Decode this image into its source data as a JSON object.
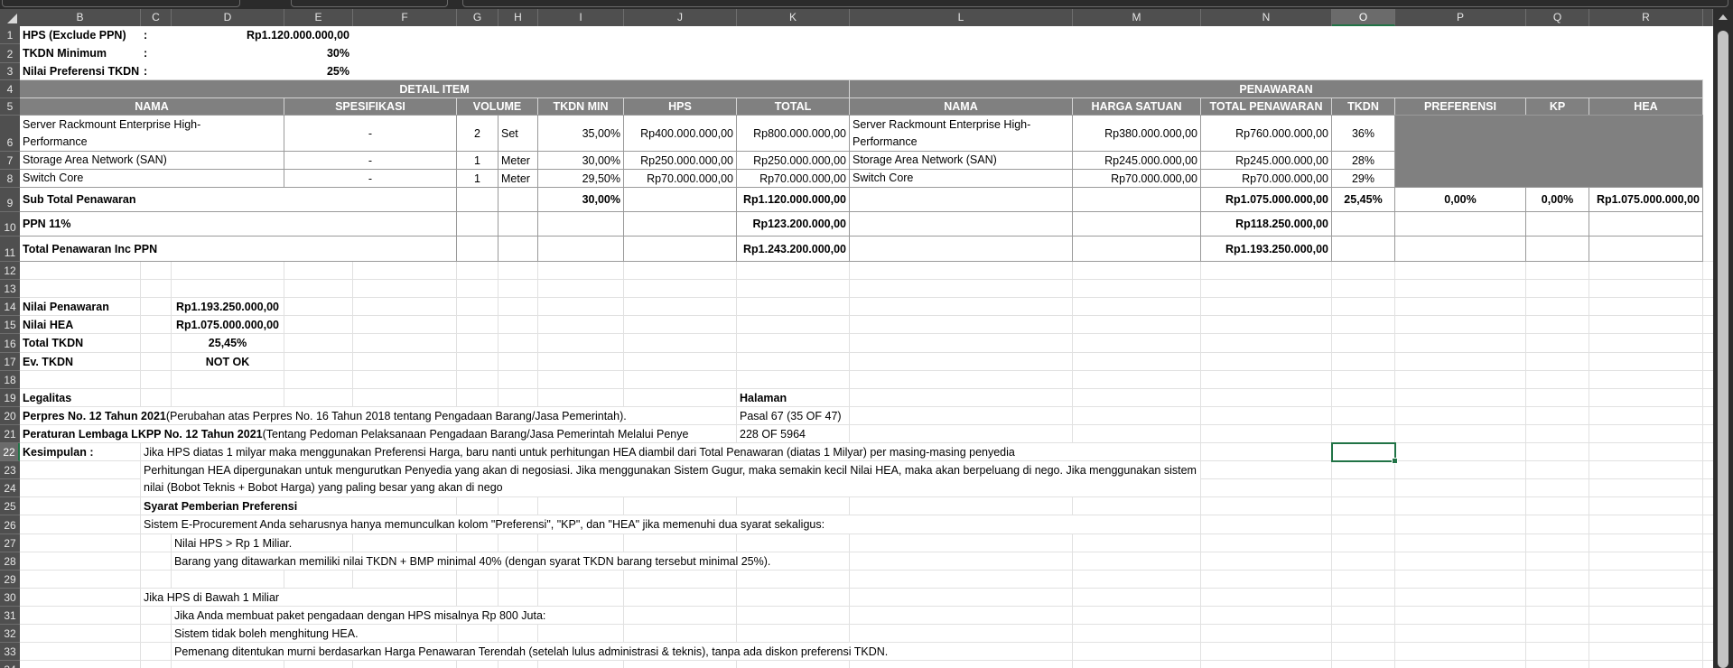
{
  "sheet": {
    "columns": [
      "B",
      "C",
      "D",
      "E",
      "F",
      "G",
      "H",
      "I",
      "J",
      "K",
      "L",
      "M",
      "N",
      "O",
      "P",
      "Q",
      "R"
    ],
    "rows": [
      "1",
      "2",
      "3",
      "4",
      "5",
      "6",
      "7",
      "8",
      "9",
      "10",
      "11",
      "12",
      "13",
      "14",
      "15",
      "16",
      "17",
      "18",
      "19",
      "20",
      "21",
      "22",
      "23",
      "24",
      "25",
      "26",
      "27",
      "28",
      "29",
      "30",
      "31",
      "32",
      "33",
      "34"
    ],
    "selected_cell": "O22",
    "accent_color": "#217346"
  },
  "summary": {
    "items": [
      {
        "label": "HPS (Exclude PPN)",
        "sep": ":",
        "value": "Rp1.120.000.000,00"
      },
      {
        "label": "TKDN Minimum",
        "sep": ":",
        "value": "30%"
      },
      {
        "label": "Nilai Preferensi TKDN",
        "sep": ":",
        "value": "25%"
      }
    ]
  },
  "table": {
    "detail_title": "DETAIL ITEM",
    "penawaran_title": "PENAWARAN",
    "headers": [
      "NAMA",
      "SPESIFIKASI",
      "VOLUME",
      "TKDN MIN",
      "HPS",
      "TOTAL",
      "NAMA",
      "HARGA SATUAN",
      "TOTAL PENAWARAN",
      "TKDN",
      "PREFERENSI",
      "KP",
      "HEA"
    ],
    "items": [
      {
        "nama": "Server Rackmount Enterprise High-Performance",
        "spesifikasi": "-",
        "volume": "2",
        "satuan": "Set",
        "tkdn_min": "35,00%",
        "hps": "Rp400.000.000,00",
        "total": "Rp800.000.000,00",
        "nama_penawaran": "Server Rackmount Enterprise High-Performance",
        "harga_satuan": "Rp380.000.000,00",
        "total_penawaran": "Rp760.000.000,00",
        "tkdn": "36%"
      },
      {
        "nama": "Storage Area Network (SAN)",
        "spesifikasi": "-",
        "volume": "1",
        "satuan": "Meter",
        "tkdn_min": "30,00%",
        "hps": "Rp250.000.000,00",
        "total": "Rp250.000.000,00",
        "nama_penawaran": "Storage Area Network (SAN)",
        "harga_satuan": "Rp245.000.000,00",
        "total_penawaran": "Rp245.000.000,00",
        "tkdn": "28%"
      },
      {
        "nama": "Switch Core",
        "spesifikasi": "-",
        "volume": "1",
        "satuan": "Meter",
        "tkdn_min": "29,50%",
        "hps": "Rp70.000.000,00",
        "total": "Rp70.000.000,00",
        "nama_penawaran": "Switch Core",
        "harga_satuan": "Rp70.000.000,00",
        "total_penawaran": "Rp70.000.000,00",
        "tkdn": "29%"
      }
    ],
    "subtotal": {
      "label": "Sub Total Penawaran",
      "tkdn_min": "30,00%",
      "total": "Rp1.120.000.000,00",
      "total_penawaran": "Rp1.075.000.000,00",
      "tkdn": "25,45%",
      "preferensi": "0,00%",
      "kp": "0,00%",
      "hea": "Rp1.075.000.000,00"
    },
    "ppn": {
      "label": "PPN 11%",
      "total": "Rp123.200.000,00",
      "total_penawaran": "Rp118.250.000,00"
    },
    "total_inc": {
      "label": "Total Penawaran Inc PPN",
      "total": "Rp1.243.200.000,00",
      "total_penawaran": "Rp1.193.250.000,00"
    }
  },
  "evaluation": [
    {
      "label": "Nilai Penawaran",
      "value": "Rp1.193.250.000,00"
    },
    {
      "label": "Nilai HEA",
      "value": "Rp1.075.000.000,00"
    },
    {
      "label": "Total TKDN",
      "value": "25,45%"
    },
    {
      "label": "Ev. TKDN",
      "value": "NOT OK"
    }
  ],
  "legal": {
    "title": "Legalitas",
    "halaman_title": "Halaman",
    "items": [
      {
        "bold": "Perpres No. 12 Tahun 2021",
        "text": " (Perubahan atas Perpres No. 16 Tahun 2018 tentang Pengadaan Barang/Jasa Pemerintah).",
        "halaman": "Pasal 67 (35 OF 47)"
      },
      {
        "bold": "Peraturan Lembaga LKPP No. 12 Tahun 2021",
        "text": " (Tentang Pedoman Pelaksanaan Pengadaan Barang/Jasa Pemerintah Melalui Penye",
        "halaman": "228 OF 5964"
      }
    ]
  },
  "kesimpulan": {
    "label": "Kesimpulan :",
    "lines": [
      "Jika HPS diatas 1 milyar maka menggunakan Preferensi Harga, baru nanti untuk perhitungan HEA diambil dari Total Penawaran (diatas 1 Milyar) per masing-masing penyedia",
      "Perhitungan HEA dipergunakan untuk mengurutkan Penyedia yang akan di negosiasi. Jika menggunakan Sistem Gugur, maka semakin kecil Nilai HEA, maka akan berpeluang di nego. Jika menggunakan sistem nilai (Bobot Teknis + Bobot Harga) yang paling besar yang akan di nego"
    ],
    "syarat_title": "Syarat Pemberian Preferensi",
    "syarat_intro": "Sistem E-Procurement Anda seharusnya hanya memunculkan kolom \"Preferensi\", \"KP\", dan \"HEA\" jika memenuhi dua syarat sekaligus:",
    "syarat_items": [
      "Nilai HPS > Rp 1 Miliar.",
      "Barang yang ditawarkan memiliki nilai TKDN + BMP minimal 40% (dengan syarat TKDN barang tersebut minimal 25%)."
    ],
    "below_title": "Jika HPS di Bawah 1 Miliar",
    "below_items": [
      "Jika Anda membuat paket pengadaan dengan HPS misalnya Rp 800 Juta:",
      "Sistem tidak boleh menghitung HEA.",
      "Pemenang ditentukan murni berdasarkan Harga Penawaran Terendah (setelah lulus administrasi & teknis), tanpa ada diskon preferensi TKDN."
    ]
  }
}
